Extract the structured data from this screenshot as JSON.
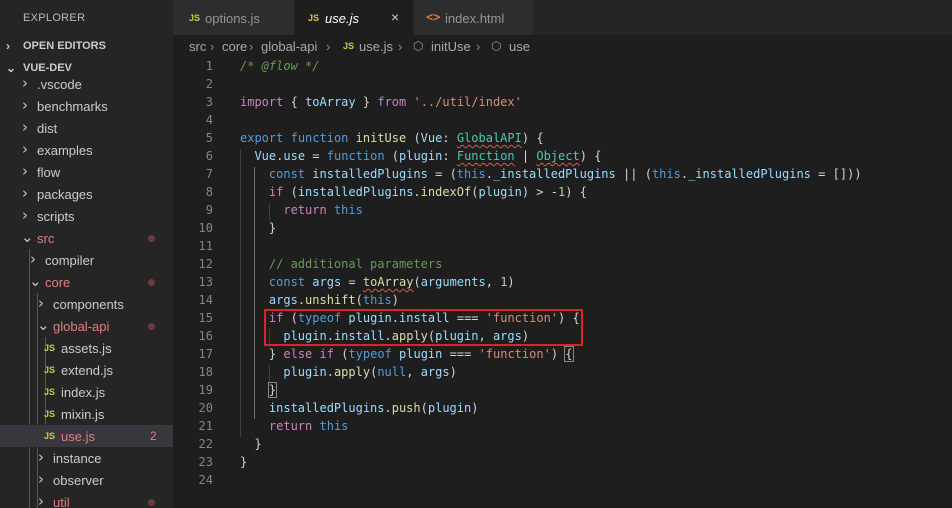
{
  "explorer": {
    "title": "EXPLORER",
    "open_editors_label": "OPEN EDITORS",
    "project_label": "VUE-DEV"
  },
  "tree": [
    {
      "label": ".vscode",
      "kind": "folder",
      "expanded": false
    },
    {
      "label": "benchmarks",
      "kind": "folder",
      "expanded": false
    },
    {
      "label": "dist",
      "kind": "folder",
      "expanded": false
    },
    {
      "label": "examples",
      "kind": "folder",
      "expanded": false
    },
    {
      "label": "flow",
      "kind": "folder",
      "expanded": false
    },
    {
      "label": "packages",
      "kind": "folder",
      "expanded": false
    },
    {
      "label": "scripts",
      "kind": "folder",
      "expanded": false
    },
    {
      "label": "src",
      "kind": "folder",
      "expanded": true,
      "modified": true
    },
    {
      "label": "compiler",
      "kind": "folder",
      "expanded": false
    },
    {
      "label": "core",
      "kind": "folder",
      "expanded": true,
      "modified": true
    },
    {
      "label": "components",
      "kind": "folder",
      "expanded": false
    },
    {
      "label": "global-api",
      "kind": "folder",
      "expanded": true,
      "modified": true
    },
    {
      "label": "assets.js",
      "kind": "file",
      "icon": "JS"
    },
    {
      "label": "extend.js",
      "kind": "file",
      "icon": "JS"
    },
    {
      "label": "index.js",
      "kind": "file",
      "icon": "JS"
    },
    {
      "label": "mixin.js",
      "kind": "file",
      "icon": "JS"
    },
    {
      "label": "use.js",
      "kind": "file",
      "icon": "JS",
      "active": true,
      "modified": true,
      "badge": "2"
    },
    {
      "label": "instance",
      "kind": "folder",
      "expanded": false
    },
    {
      "label": "observer",
      "kind": "folder",
      "expanded": false
    },
    {
      "label": "util",
      "kind": "folder",
      "expanded": false,
      "modified": true
    }
  ],
  "tabs": [
    {
      "icon": "JS",
      "label": "options.js"
    },
    {
      "icon": "JS",
      "label": "use.js",
      "active": true,
      "close": "×"
    },
    {
      "icon": "<>",
      "label": "index.html"
    }
  ],
  "breadcrumb": {
    "src": "src",
    "core": "core",
    "global_api": "global-api",
    "file_icon": "JS",
    "file": "use.js",
    "symbol1": "initUse",
    "symbol2": "use",
    "separator": "›"
  },
  "editor": {
    "line_count": 24,
    "lines": [
      "/* @flow */",
      "",
      "import { toArray } from '../util/index'",
      "",
      "export function initUse (Vue: GlobalAPI) {",
      "  Vue.use = function (plugin: Function | Object) {",
      "    const installedPlugins = (this._installedPlugins || (this._installedPlugins = []))",
      "    if (installedPlugins.indexOf(plugin) > -1) {",
      "      return this",
      "    }",
      "",
      "    // additional parameters",
      "    const args = toArray(arguments, 1)",
      "    args.unshift(this)",
      "    if (typeof plugin.install === 'function') {",
      "      plugin.install.apply(plugin, args)",
      "    } else if (typeof plugin === 'function') {",
      "      plugin.apply(null, args)",
      "    }",
      "    installedPlugins.push(plugin)",
      "    return this",
      "  }",
      "}",
      ""
    ],
    "highlighted_lines": [
      15,
      16
    ],
    "highlight_color": "#e0202c"
  },
  "colors": {
    "sidebar_bg": "#252526",
    "editor_bg": "#1e1e1e",
    "active_row_bg": "#37373d",
    "git_modified": "#e27f7f",
    "js_icon": "#cbcb41",
    "html_icon": "#e37933"
  }
}
